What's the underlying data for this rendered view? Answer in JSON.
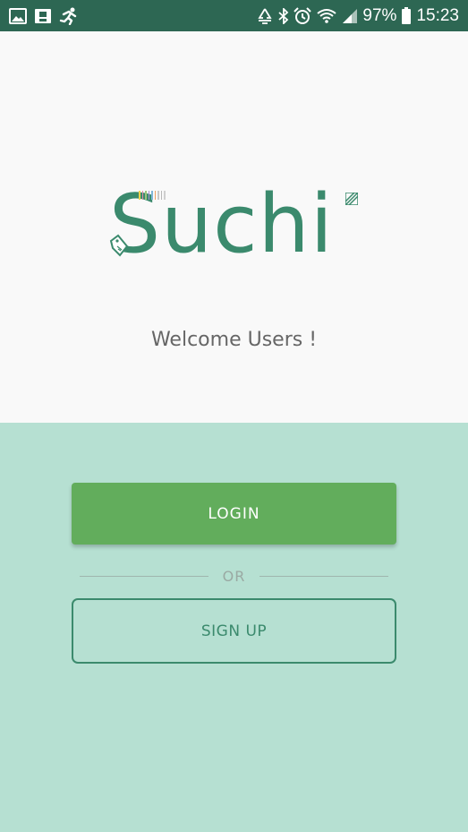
{
  "status_bar": {
    "battery_percent": "97%",
    "time": "15:23",
    "icons_left": [
      "gallery-icon",
      "photo-frame-icon",
      "running-person-icon"
    ],
    "icons_right": [
      "data-saver-icon",
      "bluetooth-icon",
      "alarm-icon",
      "wifi-icon",
      "signal-icon",
      "battery-icon"
    ],
    "background": "#2d6753"
  },
  "hero": {
    "logo_text": "Suchi",
    "welcome": "Welcome Users !",
    "logo_color": "#3b8a6d"
  },
  "actions": {
    "login_label": "LOGIN",
    "or_label": "OR",
    "signup_label": "SIGN UP",
    "login_color": "#62ad5c",
    "panel_color": "#b6e0d2"
  }
}
